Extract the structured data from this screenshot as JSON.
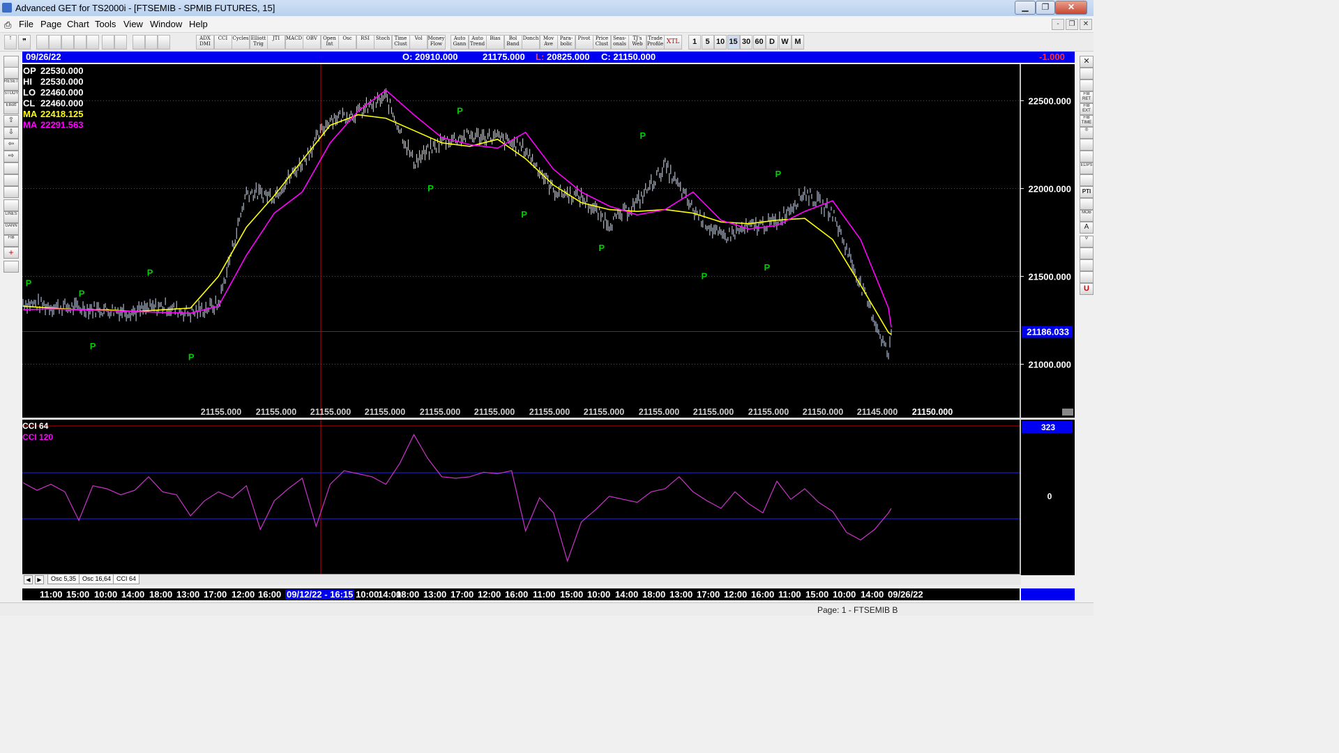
{
  "window": {
    "title": "Advanced GET for TS2000i - [FTSEMIB - SPMIB FUTURES, 15]",
    "minimize": "▁",
    "maximize": "❐",
    "close": "✕"
  },
  "menu": {
    "items": [
      "File",
      "Page",
      "Chart",
      "Tools",
      "View",
      "Window",
      "Help"
    ],
    "mdi": [
      "-",
      "❐",
      "✕"
    ]
  },
  "toolbar": {
    "studies": [
      "ADX DMI",
      "CCI",
      "Cycles",
      "Elliott Trig",
      "JTI",
      "MACD",
      "OBV",
      "Open Int",
      "Osc",
      "RSI",
      "Stoch",
      "Time Clust",
      "Vol",
      "Money Flow",
      "Auto Gann",
      "Auto Trend",
      "Bias",
      "Bol Band",
      "Donch",
      "Mov Ave",
      "Para-bolic",
      "Pivot",
      "Price Clust",
      "Seas-onals",
      "TJ's Web",
      "Trade Profile",
      "XTL"
    ],
    "periods": [
      "1",
      "5",
      "10",
      "15",
      "30",
      "60",
      "D",
      "W",
      "M"
    ]
  },
  "header": {
    "date": "09/26/22",
    "open": "O: 20910.000",
    "high": "21175.000",
    "low_label": "L:",
    "low": "20825.000",
    "close": "C: 21150.000",
    "change": "-1.000"
  },
  "legend": [
    {
      "label": "OP",
      "value": "22530.000",
      "color": "#ffffff"
    },
    {
      "label": "HI",
      "value": "22530.000",
      "color": "#ffffff"
    },
    {
      "label": "LO",
      "value": "22460.000",
      "color": "#ffffff"
    },
    {
      "label": "CL",
      "value": "22460.000",
      "color": "#ffffff"
    },
    {
      "label": "MA",
      "value": "22418.125",
      "color": "#ffff00"
    },
    {
      "label": "MA",
      "value": "22291.563",
      "color": "#ff00ff"
    }
  ],
  "price_axis": {
    "ticks": [
      "22500.000",
      "22000.000",
      "21500.000",
      "21000.000"
    ],
    "current": "21186.033"
  },
  "bottom_values": [
    "21155.000",
    "21155.000",
    "21155.000",
    "21155.000",
    "21155.000",
    "21155.000",
    "21155.000",
    "21155.000",
    "21155.000",
    "21155.000",
    "21155.000",
    "21150.000",
    "21145.000",
    "21150.000"
  ],
  "pivot_marker": "P",
  "osc": {
    "label1": "CCI 64",
    "label2": "CCI  120",
    "ticks": [
      "323",
      "0"
    ]
  },
  "tabs": [
    "Osc 5,35",
    "Osc 16,64",
    "CCI 64"
  ],
  "time_axis": [
    "11:00",
    "15:00",
    "10:00",
    "14:00",
    "18:00",
    "13:00",
    "17:00",
    "12:00",
    "16:00",
    "09/12/22 - 16:15",
    "10:00",
    "14:00",
    "18:00",
    "13:00",
    "17:00",
    "12:00",
    "16:00",
    "11:00",
    "15:00",
    "10:00",
    "14:00",
    "18:00",
    "13:00",
    "17:00",
    "12:00",
    "16:00",
    "11:00",
    "15:00",
    "10:00",
    "14:00",
    "09/26/22"
  ],
  "status": {
    "page": "Page: 1 - FTSEMIB B"
  },
  "colors": {
    "ma_fast": "#ffff00",
    "ma_slow": "#ff00ff",
    "bars": "#b8c8e8",
    "pivot": "#00cc00",
    "cci": "#cc33cc",
    "hline": "#cc0000",
    "blueband": "#0000f0"
  },
  "chart_data": [
    {
      "type": "line",
      "title": "",
      "ylim": [
        20700,
        22700
      ],
      "series": [
        {
          "name": "",
          "x": [
            0,
            40,
            80,
            120,
            160,
            200,
            240,
            280,
            320,
            360,
            400,
            440,
            480,
            520,
            560,
            600,
            640,
            680,
            720,
            760,
            800,
            840,
            880,
            920,
            960,
            1000,
            1040,
            1080,
            1120,
            1160,
            1200,
            1240,
            1244
          ],
          "values": [
            21350,
            21330,
            21320,
            21310,
            21300,
            21330,
            21290,
            21340,
            21980,
            21960,
            22150,
            22400,
            22430,
            22520,
            22150,
            22270,
            22300,
            22290,
            22220,
            21990,
            21950,
            21800,
            21920,
            22130,
            21880,
            21720,
            21780,
            21810,
            21980,
            21860,
            21450,
            21050,
            21160
          ]
        },
        {
          "name": "MA",
          "x": [
            0,
            40,
            80,
            120,
            160,
            200,
            240,
            280,
            320,
            360,
            400,
            440,
            480,
            520,
            560,
            600,
            640,
            680,
            720,
            760,
            800,
            840,
            880,
            920,
            960,
            1000,
            1040,
            1080,
            1120,
            1160,
            1200,
            1240,
            1244
          ],
          "values": [
            21330,
            21320,
            21310,
            21310,
            21300,
            21310,
            21320,
            21500,
            21780,
            21960,
            22160,
            22360,
            22420,
            22400,
            22330,
            22260,
            22240,
            22280,
            22170,
            22020,
            21920,
            21880,
            21870,
            21880,
            21860,
            21810,
            21800,
            21820,
            21830,
            21710,
            21450,
            21180,
            21170
          ]
        },
        {
          "name": "MA",
          "x": [
            0,
            40,
            80,
            120,
            160,
            200,
            240,
            280,
            320,
            360,
            400,
            440,
            480,
            520,
            560,
            600,
            640,
            680,
            720,
            760,
            800,
            840,
            880,
            920,
            960,
            1000,
            1040,
            1080,
            1120,
            1160,
            1200,
            1240,
            1244
          ],
          "values": [
            21310,
            21315,
            21310,
            21305,
            21300,
            21295,
            21290,
            21330,
            21620,
            21860,
            21980,
            22260,
            22440,
            22560,
            22420,
            22290,
            22250,
            22230,
            22320,
            22110,
            21980,
            21900,
            21850,
            21880,
            21980,
            21820,
            21770,
            21790,
            21870,
            21930,
            21710,
            21320,
            21210
          ]
        }
      ],
      "pivots": [
        {
          "x": 8,
          "value": 21460
        },
        {
          "x": 84,
          "value": 21400
        },
        {
          "x": 100,
          "value": 21100
        },
        {
          "x": 182,
          "value": 21520
        },
        {
          "x": 241,
          "value": 21040
        },
        {
          "x": 584,
          "value": 22000
        },
        {
          "x": 626,
          "value": 22440
        },
        {
          "x": 718,
          "value": 21850
        },
        {
          "x": 829,
          "value": 21660
        },
        {
          "x": 888,
          "value": 22300
        },
        {
          "x": 976,
          "value": 21500
        },
        {
          "x": 1066,
          "value": 21550
        },
        {
          "x": 1082,
          "value": 22080
        }
      ]
    },
    {
      "type": "line",
      "title": "",
      "ylim": [
        -600,
        400
      ],
      "series": [
        {
          "name": "CCI 64",
          "x": [
            0,
            20,
            40,
            60,
            80,
            100,
            120,
            140,
            160,
            180,
            200,
            220,
            240,
            260,
            280,
            300,
            320,
            340,
            360,
            380,
            400,
            420,
            440,
            460,
            480,
            500,
            520,
            540,
            560,
            580,
            600,
            620,
            640,
            660,
            680,
            700,
            720,
            740,
            760,
            780,
            800,
            820,
            840,
            860,
            880,
            900,
            920,
            940,
            960,
            980,
            1000,
            1020,
            1040,
            1060,
            1080,
            1100,
            1120,
            1140,
            1160,
            1180,
            1200,
            1220,
            1240,
            1244
          ],
          "values": [
            0,
            -50,
            -10,
            -60,
            -250,
            -20,
            -40,
            -80,
            -50,
            40,
            -60,
            -80,
            -220,
            -120,
            -60,
            -100,
            -20,
            -310,
            -120,
            -40,
            30,
            -290,
            -10,
            80,
            60,
            40,
            -10,
            130,
            320,
            160,
            40,
            30,
            40,
            70,
            60,
            80,
            -320,
            -100,
            -200,
            -520,
            -260,
            -180,
            -90,
            -110,
            -130,
            -60,
            -40,
            40,
            -60,
            -120,
            -170,
            -60,
            -140,
            -200,
            10,
            -110,
            -40,
            -130,
            -190,
            -330,
            -380,
            -310,
            -200,
            -170
          ]
        }
      ]
    }
  ]
}
